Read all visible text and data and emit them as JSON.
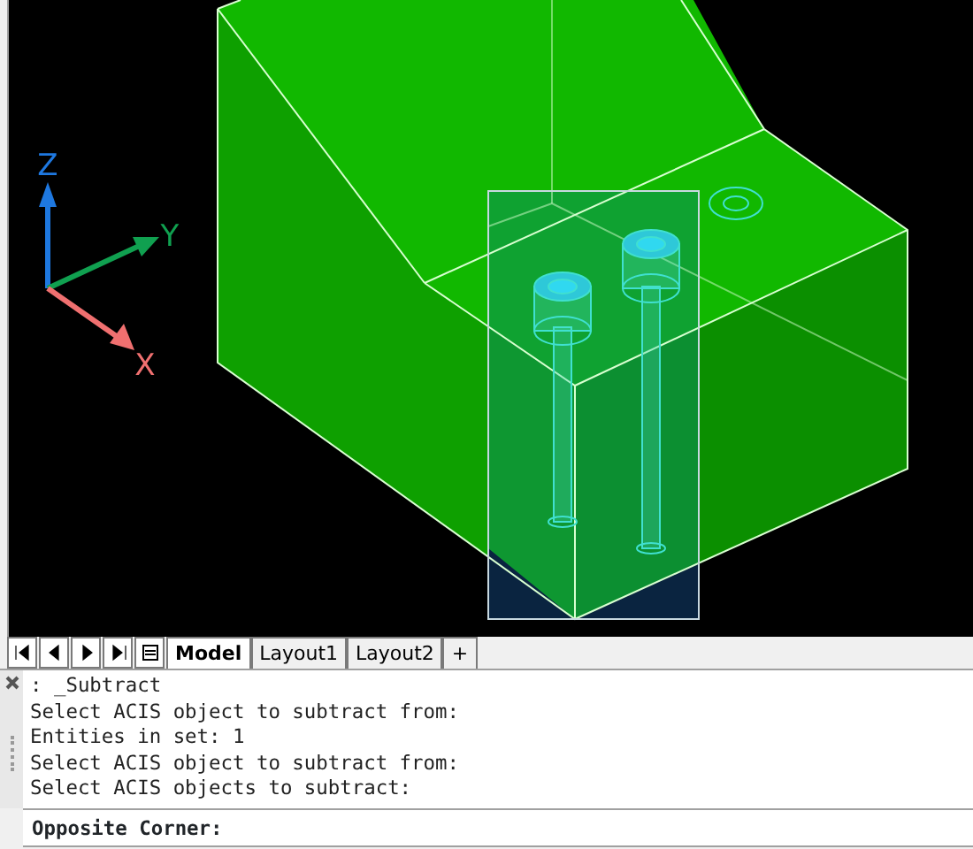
{
  "viewport": {
    "ucs_axes": [
      {
        "label": "Z"
      },
      {
        "label": "Y"
      },
      {
        "label": "X"
      }
    ]
  },
  "layout_tabs": [
    {
      "label": "Model",
      "selected": true
    },
    {
      "label": "Layout1",
      "selected": false
    },
    {
      "label": "Layout2",
      "selected": false
    },
    {
      "label": "+",
      "selected": false
    }
  ],
  "command_history": [
    ": _Subtract",
    "Select ACIS object to subtract from:",
    "Entities in set: 1",
    "Select ACIS object to subtract from:",
    "Select ACIS objects to subtract:"
  ],
  "command_prompt": "Opposite Corner:"
}
